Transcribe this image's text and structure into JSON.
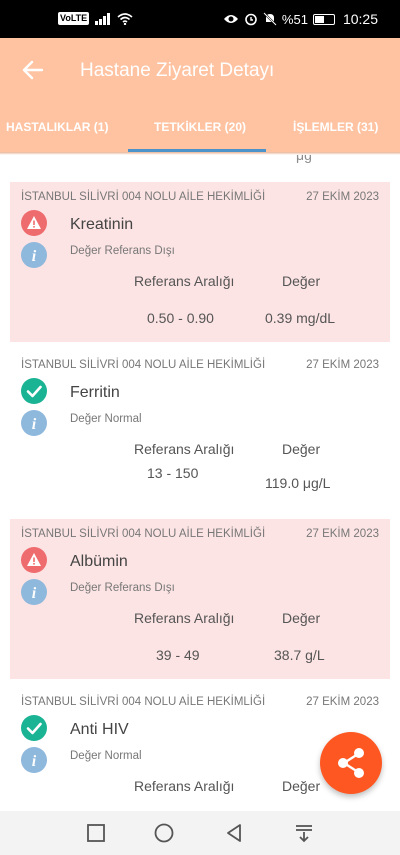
{
  "status_bar": {
    "volte": "VoLTE",
    "battery_label": "%51",
    "battery_level": 0.51,
    "time": "10:25"
  },
  "appbar": {
    "title": "Hastane Ziyaret Detayı"
  },
  "tabs": [
    {
      "label": "HASTALIKLAR (1)"
    },
    {
      "label": "TETKİKLER (20)"
    },
    {
      "label": "İŞLEMLER (31)"
    }
  ],
  "peek_text": "μg",
  "cards": [
    {
      "hospital": "İSTANBUL SİLİVRİ 004 NOLU AİLE HEKİMLİĞİ",
      "date": "27 EKİM 2023",
      "name": "Kreatinin",
      "status": "Değer Referans Dışı",
      "ref_header": "Referans Aralığı",
      "value_header": "Değer",
      "ref_range": "0.50 - 0.90",
      "value": "0.39 mg/dL"
    },
    {
      "hospital": "İSTANBUL SİLİVRİ 004 NOLU AİLE HEKİMLİĞİ",
      "date": "27 EKİM 2023",
      "name": "Ferritin",
      "status": "Değer Normal",
      "ref_header": "Referans Aralığı",
      "value_header": "Değer",
      "ref_range": "13 - 150",
      "value": "119.0 μg/L"
    },
    {
      "hospital": "İSTANBUL SİLİVRİ 004 NOLU AİLE HEKİMLİĞİ",
      "date": "27 EKİM 2023",
      "name": "Albümin",
      "status": "Değer Referans Dışı",
      "ref_header": "Referans Aralığı",
      "value_header": "Değer",
      "ref_range": "39 - 49",
      "value": "38.7 g/L"
    },
    {
      "hospital": "İSTANBUL SİLİVRİ 004 NOLU AİLE HEKİMLİĞİ",
      "date": "27 EKİM 2023",
      "name": "Anti HIV",
      "status": "Değer Normal",
      "ref_header": "Referans Aralığı",
      "value_header": "Değer"
    }
  ],
  "colors": {
    "accent": "#ffc3a2",
    "abnormal_bg": "#fde4e4",
    "warn": "#ee6b6e",
    "ok": "#1ab394",
    "info": "#8fb8dd",
    "fab": "#ff5722",
    "tab_indicator": "#4b93c9"
  },
  "icons": {
    "back": "arrow-left-icon",
    "warn": "warning-triangle-icon",
    "ok": "check-icon",
    "info": "info-icon",
    "fab": "share-icon"
  }
}
